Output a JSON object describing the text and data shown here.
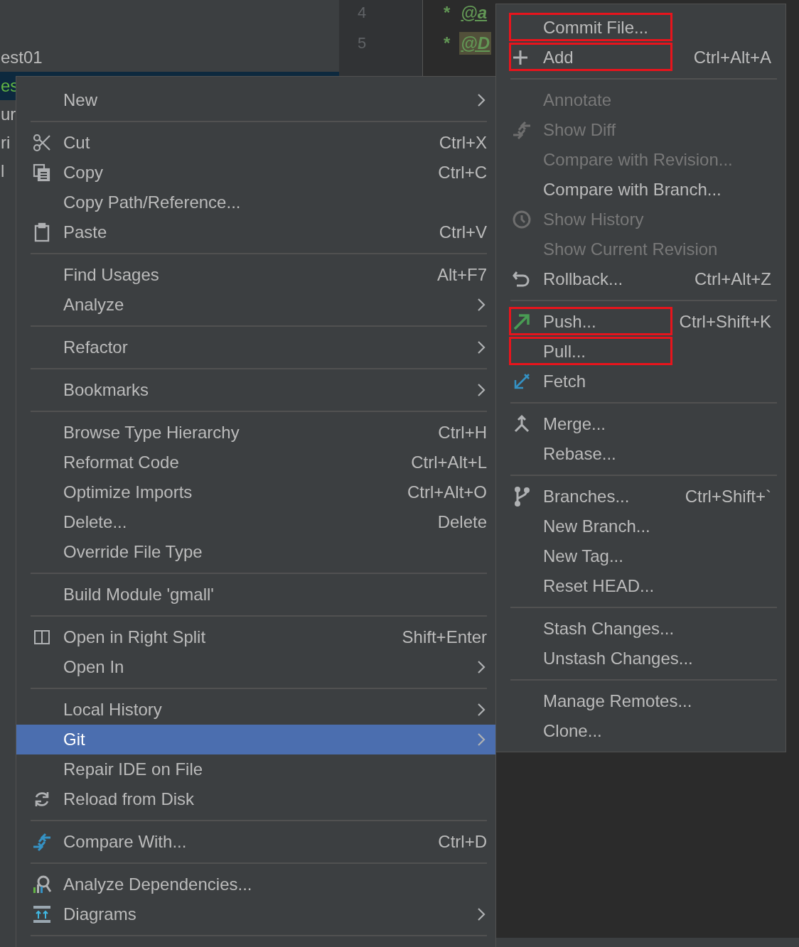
{
  "project_tree": [
    {
      "text": "est01",
      "selected": false,
      "color": "#bbbbbb"
    },
    {
      "text": "es",
      "selected": true,
      "color": "#62b543"
    },
    {
      "text": "ur",
      "selected": false,
      "color": "#bbbbbb"
    },
    {
      "text": "ri",
      "selected": false,
      "color": "#bbbbbb"
    },
    {
      "text": "l",
      "selected": false,
      "color": "#bbbbbb"
    }
  ],
  "editor_lines": [
    {
      "number": "4",
      "star": "*",
      "tag": "@a",
      "marked": false
    },
    {
      "number": "5",
      "star": "*",
      "tag": "@D",
      "marked": true
    }
  ],
  "context_menu": {
    "items": [
      {
        "kind": "item",
        "label": "New",
        "submenu": true,
        "selected": false
      },
      {
        "kind": "separator"
      },
      {
        "kind": "item",
        "label": "Cut",
        "shortcut": "Ctrl+X",
        "selected": false
      },
      {
        "kind": "item",
        "label": "Copy",
        "shortcut": "Ctrl+C",
        "selected": false
      },
      {
        "kind": "item",
        "label": "Copy Path/Reference...",
        "selected": false
      },
      {
        "kind": "item",
        "label": "Paste",
        "shortcut": "Ctrl+V",
        "selected": false
      },
      {
        "kind": "separator"
      },
      {
        "kind": "item",
        "label": "Find Usages",
        "shortcut": "Alt+F7",
        "selected": false
      },
      {
        "kind": "item",
        "label": "Analyze",
        "submenu": true,
        "selected": false
      },
      {
        "kind": "separator"
      },
      {
        "kind": "item",
        "label": "Refactor",
        "submenu": true,
        "selected": false
      },
      {
        "kind": "separator"
      },
      {
        "kind": "item",
        "label": "Bookmarks",
        "submenu": true,
        "selected": false
      },
      {
        "kind": "separator"
      },
      {
        "kind": "item",
        "label": "Browse Type Hierarchy",
        "shortcut": "Ctrl+H",
        "selected": false
      },
      {
        "kind": "item",
        "label": "Reformat Code",
        "shortcut": "Ctrl+Alt+L",
        "selected": false
      },
      {
        "kind": "item",
        "label": "Optimize Imports",
        "shortcut": "Ctrl+Alt+O",
        "selected": false
      },
      {
        "kind": "item",
        "label": "Delete...",
        "shortcut": "Delete",
        "selected": false
      },
      {
        "kind": "item",
        "label": "Override File Type",
        "selected": false
      },
      {
        "kind": "separator"
      },
      {
        "kind": "item",
        "label": "Build Module 'gmall'",
        "selected": false
      },
      {
        "kind": "separator"
      },
      {
        "kind": "item",
        "label": "Open in Right Split",
        "shortcut": "Shift+Enter",
        "selected": false
      },
      {
        "kind": "item",
        "label": "Open In",
        "submenu": true,
        "selected": false
      },
      {
        "kind": "separator"
      },
      {
        "kind": "item",
        "label": "Local History",
        "submenu": true,
        "selected": false
      },
      {
        "kind": "item",
        "label": "Git",
        "submenu": true,
        "selected": true
      },
      {
        "kind": "item",
        "label": "Repair IDE on File",
        "selected": false
      },
      {
        "kind": "item",
        "label": "Reload from Disk",
        "selected": false
      },
      {
        "kind": "separator"
      },
      {
        "kind": "item",
        "label": "Compare With...",
        "shortcut": "Ctrl+D",
        "selected": false
      },
      {
        "kind": "separator"
      },
      {
        "kind": "item",
        "label": "Analyze Dependencies...",
        "selected": false
      },
      {
        "kind": "item",
        "label": "Diagrams",
        "submenu": true,
        "selected": false
      },
      {
        "kind": "separator"
      }
    ]
  },
  "git_submenu": {
    "items": [
      {
        "kind": "item",
        "label": "Commit File...",
        "disabled": false,
        "annotated": true
      },
      {
        "kind": "item",
        "label": "Add",
        "shortcut": "Ctrl+Alt+A",
        "disabled": false,
        "annotated": true
      },
      {
        "kind": "separator"
      },
      {
        "kind": "item",
        "label": "Annotate",
        "disabled": true,
        "annotated": false
      },
      {
        "kind": "item",
        "label": "Show Diff",
        "disabled": true,
        "annotated": false
      },
      {
        "kind": "item",
        "label": "Compare with Revision...",
        "disabled": true,
        "annotated": false
      },
      {
        "kind": "item",
        "label": "Compare with Branch...",
        "disabled": false,
        "annotated": false
      },
      {
        "kind": "item",
        "label": "Show History",
        "disabled": true,
        "annotated": false
      },
      {
        "kind": "item",
        "label": "Show Current Revision",
        "disabled": true,
        "annotated": false
      },
      {
        "kind": "item",
        "label": "Rollback...",
        "shortcut": "Ctrl+Alt+Z",
        "disabled": false,
        "annotated": false
      },
      {
        "kind": "separator"
      },
      {
        "kind": "item",
        "label": "Push...",
        "shortcut": "Ctrl+Shift+K",
        "disabled": false,
        "annotated": true
      },
      {
        "kind": "item",
        "label": "Pull...",
        "disabled": false,
        "annotated": true
      },
      {
        "kind": "item",
        "label": "Fetch",
        "disabled": false,
        "annotated": false
      },
      {
        "kind": "separator"
      },
      {
        "kind": "item",
        "label": "Merge...",
        "disabled": false,
        "annotated": false
      },
      {
        "kind": "item",
        "label": "Rebase...",
        "disabled": false,
        "annotated": false
      },
      {
        "kind": "separator"
      },
      {
        "kind": "item",
        "label": "Branches...",
        "shortcut": "Ctrl+Shift+`",
        "disabled": false,
        "annotated": false
      },
      {
        "kind": "item",
        "label": "New Branch...",
        "disabled": false,
        "annotated": false
      },
      {
        "kind": "item",
        "label": "New Tag...",
        "disabled": false,
        "annotated": false
      },
      {
        "kind": "item",
        "label": "Reset HEAD...",
        "disabled": false,
        "annotated": false
      },
      {
        "kind": "separator"
      },
      {
        "kind": "item",
        "label": "Stash Changes...",
        "disabled": false,
        "annotated": false
      },
      {
        "kind": "item",
        "label": "Unstash Changes...",
        "disabled": false,
        "annotated": false
      },
      {
        "kind": "separator"
      },
      {
        "kind": "item",
        "label": "Manage Remotes...",
        "disabled": false,
        "annotated": false
      },
      {
        "kind": "item",
        "label": "Clone...",
        "disabled": false,
        "annotated": false
      }
    ]
  }
}
